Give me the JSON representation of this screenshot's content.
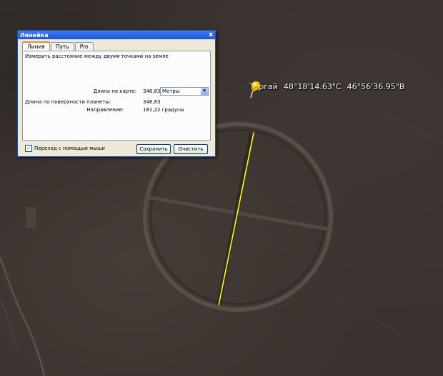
{
  "ruler": {
    "title": "Линейка",
    "close_glyph": "x",
    "tabs": [
      {
        "label": "Линия"
      },
      {
        "label": "Путь"
      },
      {
        "label": "Pro"
      }
    ],
    "description": "Измерить расстояние между двумя точками на земле",
    "map_length": {
      "label": "Длина по карте:",
      "value": "346,83",
      "unit": "Метры"
    },
    "surface_length": {
      "label": "Длина по поверхности планеты:",
      "value": "346,83"
    },
    "heading": {
      "label": "Направление:",
      "value": "181,22 градусы"
    },
    "mouse_nav": {
      "label": "Переход с помощью мыши",
      "checked": true
    },
    "save_label": "Сохранить",
    "clear_label": "Очистить"
  },
  "placemark": {
    "name": "Тургай",
    "lat": "48°18'14.63\"С",
    "lon": "46°56'36.95\"В",
    "icon": "pushpin-icon"
  },
  "colors": {
    "measure_line": "#ffff00",
    "terrain": "#39322e",
    "title_bar": "#2a63dd"
  }
}
